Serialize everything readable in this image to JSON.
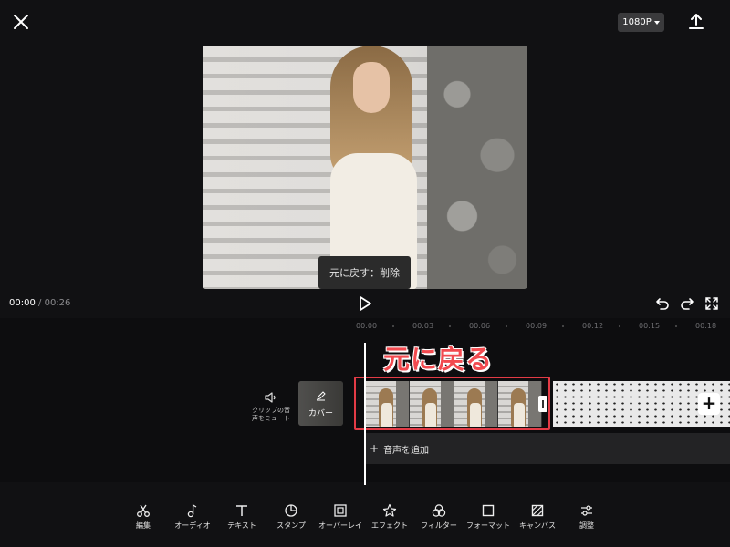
{
  "header": {
    "resolution": "1080P",
    "close_icon": "close-icon",
    "export_icon": "export-icon"
  },
  "preview": {
    "toast": "元に戻す：削除"
  },
  "playback": {
    "current_time": "00:00",
    "separator": "/",
    "duration": "00:26"
  },
  "ruler": [
    "00:00",
    "00:03",
    "00:06",
    "00:09",
    "00:12",
    "00:15",
    "00:18"
  ],
  "annotation": "元に戻る",
  "track": {
    "mute_label_1": "クリップの音",
    "mute_label_2": "声をミュート",
    "cover_label": "カバー",
    "add_audio": "音声を追加"
  },
  "toolbar": [
    {
      "label": "編集",
      "icon": "scissors-icon"
    },
    {
      "label": "オーディオ",
      "icon": "music-note-icon"
    },
    {
      "label": "テキスト",
      "icon": "text-icon"
    },
    {
      "label": "スタンプ",
      "icon": "sticker-icon"
    },
    {
      "label": "オーバーレイ",
      "icon": "overlay-icon"
    },
    {
      "label": "エフェクト",
      "icon": "effect-star-icon"
    },
    {
      "label": "フィルター",
      "icon": "filter-icon"
    },
    {
      "label": "フォーマット",
      "icon": "format-square-icon"
    },
    {
      "label": "キャンバス",
      "icon": "canvas-icon"
    },
    {
      "label": "調整",
      "icon": "adjust-sliders-icon"
    }
  ]
}
